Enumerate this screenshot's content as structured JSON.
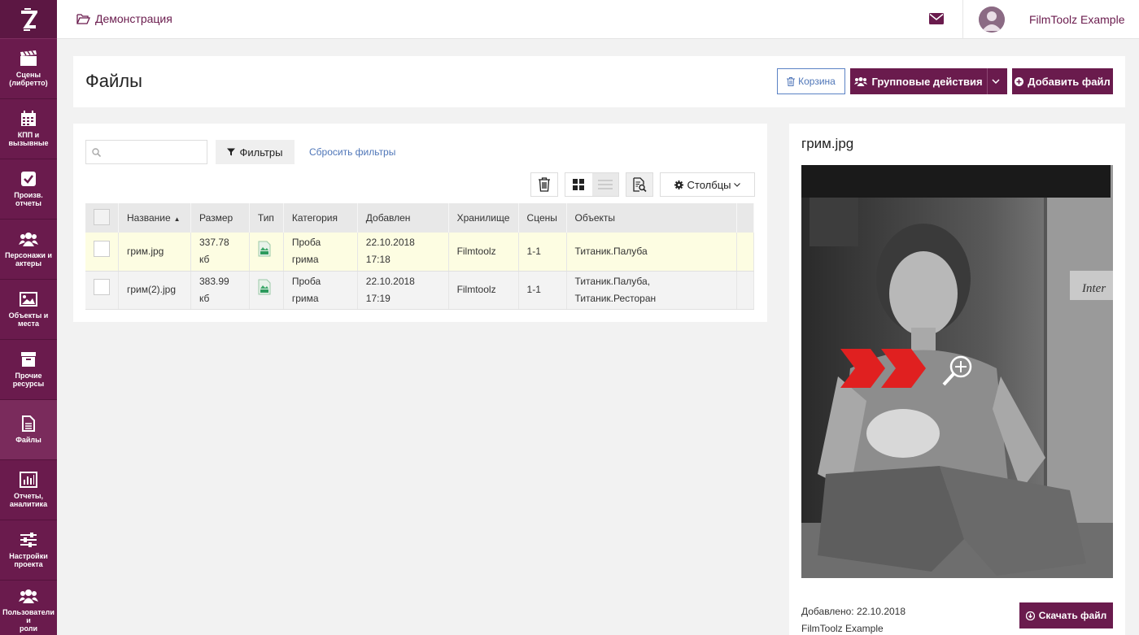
{
  "sidebar": {
    "items": [
      {
        "label": "Сцены\n(либретто)",
        "icon": "clapperboard-icon"
      },
      {
        "label": "КПП и\nвызывные",
        "icon": "calendar-icon"
      },
      {
        "label": "Произв.\nотчеты",
        "icon": "check-square-icon"
      },
      {
        "label": "Персонажи и\nактеры",
        "icon": "users-icon"
      },
      {
        "label": "Объекты и\nместа",
        "icon": "image-icon"
      },
      {
        "label": "Прочие\nресурсы",
        "icon": "archive-icon"
      },
      {
        "label": "Файлы",
        "icon": "file-icon"
      },
      {
        "label": "Отчеты,\nаналитика",
        "icon": "bar-chart-icon"
      },
      {
        "label": "Настройки\nпроекта",
        "icon": "sliders-icon"
      },
      {
        "label": "Пользователи и\nроли",
        "icon": "users-icon"
      }
    ]
  },
  "topbar": {
    "breadcrumb": "Демонстрация",
    "username": "FilmToolz Example"
  },
  "header": {
    "title": "Файлы",
    "trash_label": "Корзина",
    "group_actions_label": "Групповые действия",
    "add_file_label": "Добавить файл"
  },
  "filters": {
    "search_placeholder": "",
    "filter_label": "Фильтры",
    "reset_label": "Сбросить фильтры",
    "columns_label": "Столбцы"
  },
  "table": {
    "headers": [
      "Название",
      "Размер",
      "Тип",
      "Категория",
      "Добавлен",
      "Хранилище",
      "Сцены",
      "Объекты"
    ],
    "rows": [
      {
        "name": "грим.jpg",
        "size": "337.78\nкб",
        "category": "Проба\nгрима",
        "added": "22.10.2018\n17:18",
        "storage": "Filmtoolz",
        "scenes": "1-1",
        "objects": "Титаник.Палуба"
      },
      {
        "name": "грим(2).jpg",
        "size": "383.99\nкб",
        "category": "Проба\nгрима",
        "added": "22.10.2018\n17:19",
        "storage": "Filmtoolz",
        "scenes": "1-1",
        "objects": "Титаник.Палуба,\nТитаник.Ресторан"
      }
    ]
  },
  "preview": {
    "title": "грим.jpg",
    "added_line": "Добавлено: 22.10.2018",
    "author_line": "FilmToolz Example",
    "download_label": "Скачать файл",
    "image_caption": "Inter"
  },
  "colors": {
    "brand": "#6a1b4d",
    "link": "#4f76b8",
    "selected_row": "#fdfde2"
  }
}
